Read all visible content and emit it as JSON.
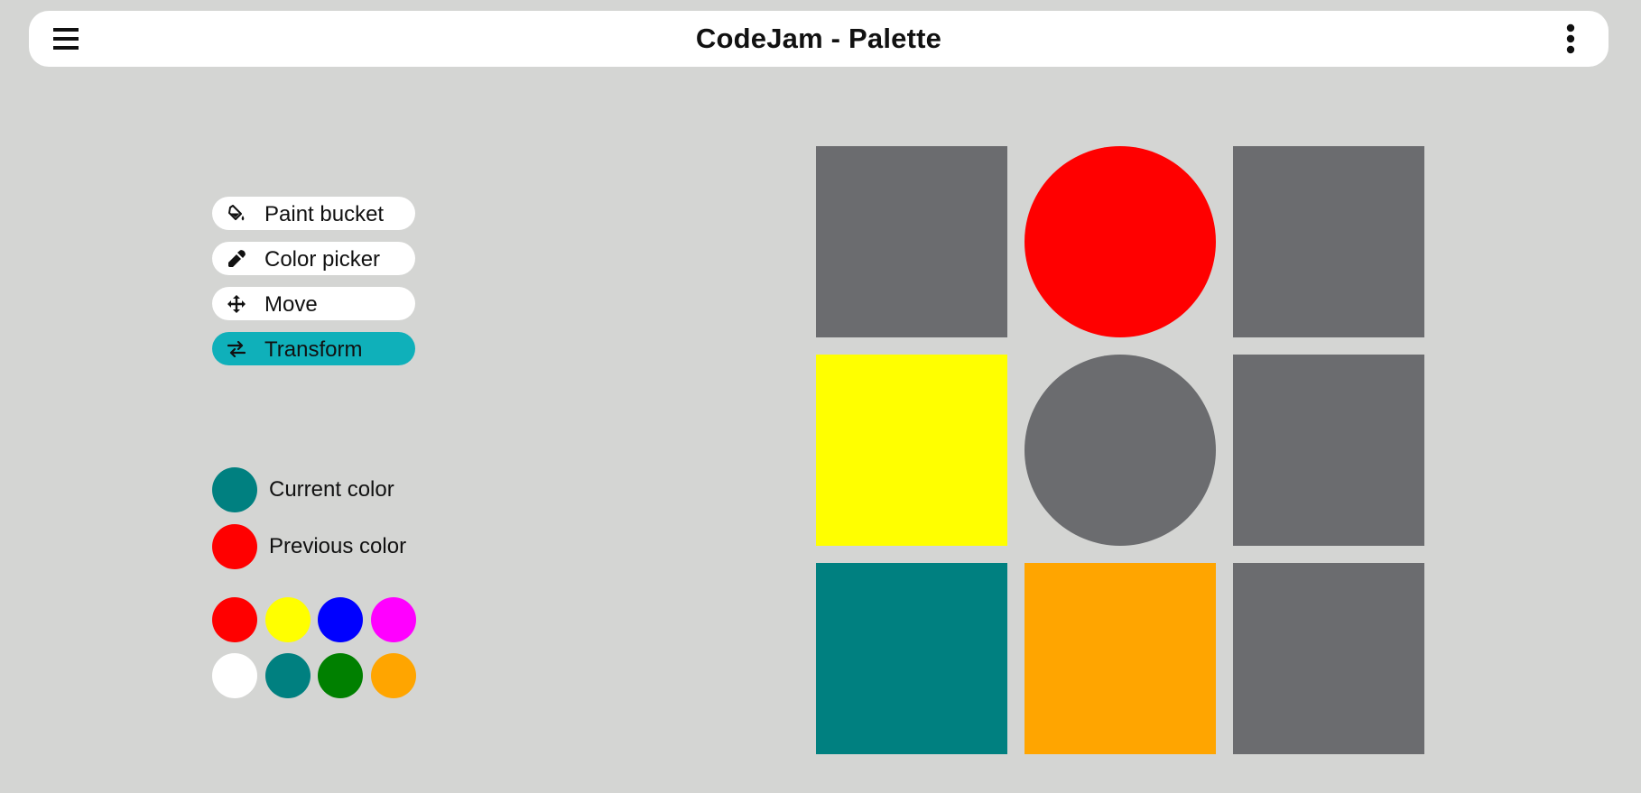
{
  "header": {
    "title": "CodeJam - Palette",
    "menu_icon": "hamburger-menu-icon",
    "more_icon": "vertical-dots-icon"
  },
  "tools": [
    {
      "label": "Paint bucket",
      "icon": "paint-bucket-icon",
      "active": false
    },
    {
      "label": "Color picker",
      "icon": "eyedropper-icon",
      "active": false
    },
    {
      "label": "Move",
      "icon": "move-arrows-icon",
      "active": false
    },
    {
      "label": "Transform",
      "icon": "swap-arrows-icon",
      "active": true
    }
  ],
  "color_status": {
    "current": {
      "label": "Current color",
      "color": "#008080"
    },
    "previous": {
      "label": "Previous color",
      "color": "#ff0000"
    }
  },
  "palette": [
    "#ff0000",
    "#ffff00",
    "#0000ff",
    "#ff00ff",
    "#ffffff",
    "#008080",
    "#008000",
    "#ffa500"
  ],
  "canvas": {
    "cells": [
      {
        "shape": "square",
        "color": "#6b6c6f"
      },
      {
        "shape": "circle",
        "color": "#ff0000"
      },
      {
        "shape": "square",
        "color": "#6b6c6f"
      },
      {
        "shape": "square",
        "color": "#ffff00"
      },
      {
        "shape": "circle",
        "color": "#6b6c6f"
      },
      {
        "shape": "square",
        "color": "#6b6c6f"
      },
      {
        "shape": "square",
        "color": "#008080"
      },
      {
        "shape": "square",
        "color": "#ffa500"
      },
      {
        "shape": "square",
        "color": "#6b6c6f"
      }
    ]
  },
  "colors": {
    "background": "#d4d5d3",
    "active_tool": "#0fb0ba"
  }
}
